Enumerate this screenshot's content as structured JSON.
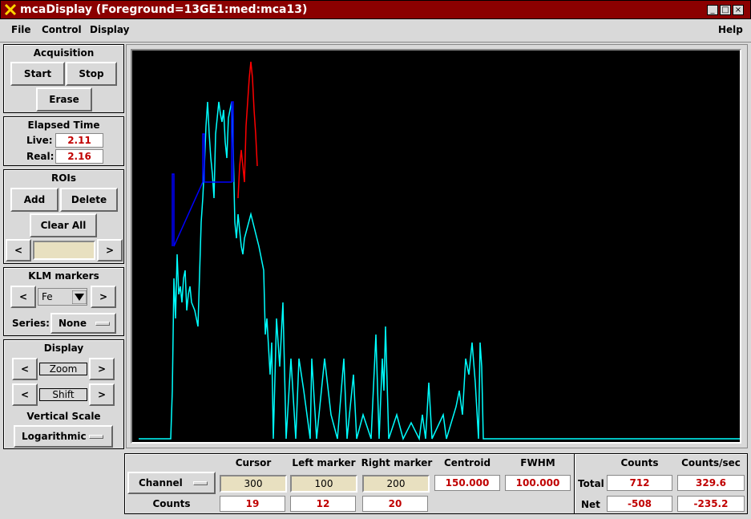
{
  "window": {
    "title": "mcaDisplay (Foreground=13GE1:med:mca13)"
  },
  "menu": {
    "file": "File",
    "control": "Control",
    "display": "Display",
    "help": "Help"
  },
  "acquisition": {
    "title": "Acquisition",
    "start": "Start",
    "stop": "Stop",
    "erase": "Erase"
  },
  "elapsed": {
    "title": "Elapsed Time",
    "live_label": "Live:",
    "live_value": "2.11",
    "real_label": "Real:",
    "real_value": "2.16"
  },
  "rois": {
    "title": "ROIs",
    "add": "Add",
    "delete": "Delete",
    "clear_all": "Clear All",
    "prev": "<",
    "next": ">",
    "field_value": ""
  },
  "klm": {
    "title": "KLM markers",
    "prev": "<",
    "next": ">",
    "element": "Fe",
    "series_label": "Series:",
    "series_value": "None"
  },
  "display_panel": {
    "title": "Display",
    "zoom": "Zoom",
    "shift": "Shift",
    "prev": "<",
    "next": ">",
    "vscale_title": "Vertical Scale",
    "vscale_value": "Logarithmic"
  },
  "bottom": {
    "mode": "Channel",
    "headers": {
      "cursor": "Cursor",
      "left": "Left marker",
      "right": "Right marker",
      "centroid": "Centroid",
      "fwhm": "FWHM"
    },
    "cursor_value": "300",
    "left_value": "100",
    "right_value": "200",
    "centroid_value": "150.000",
    "fwhm_value": "100.000",
    "counts_label": "Counts",
    "cursor_counts": "19",
    "left_counts": "12",
    "right_counts": "20"
  },
  "totals": {
    "counts_header": "Counts",
    "cps_header": "Counts/sec",
    "total_label": "Total",
    "total_counts": "712",
    "total_cps": "329.6",
    "net_label": "Net",
    "net_counts": "-508",
    "net_cps": "-235.2"
  },
  "colors": {
    "title_bg": "#8b0000",
    "spectrum": "#00ffff",
    "roi": "#ff0000",
    "marker": "#0000ff",
    "value_text": "#c00000"
  },
  "chart_data": {
    "type": "line",
    "description_scale": "logarithmic",
    "series": [
      {
        "color": "#00ffff",
        "points": [
          [
            0,
            0
          ],
          [
            40,
            0
          ],
          [
            42,
            60
          ],
          [
            44,
            200
          ],
          [
            46,
            150
          ],
          [
            48,
            230
          ],
          [
            50,
            180
          ],
          [
            52,
            190
          ],
          [
            54,
            170
          ],
          [
            56,
            200
          ],
          [
            58,
            210
          ],
          [
            60,
            160
          ],
          [
            62,
            180
          ],
          [
            64,
            190
          ],
          [
            66,
            170
          ],
          [
            70,
            160
          ],
          [
            74,
            140
          ],
          [
            78,
            270
          ],
          [
            80,
            300
          ],
          [
            82,
            340
          ],
          [
            84,
            390
          ],
          [
            86,
            420
          ],
          [
            88,
            380
          ],
          [
            90,
            350
          ],
          [
            92,
            330
          ],
          [
            94,
            300
          ],
          [
            96,
            380
          ],
          [
            98,
            400
          ],
          [
            100,
            420
          ],
          [
            102,
            405
          ],
          [
            104,
            395
          ],
          [
            106,
            410
          ],
          [
            108,
            370
          ],
          [
            110,
            350
          ],
          [
            112,
            400
          ],
          [
            114,
            410
          ],
          [
            116,
            420
          ],
          [
            118,
            360
          ],
          [
            120,
            270
          ],
          [
            122,
            250
          ],
          [
            124,
            280
          ],
          [
            126,
            260
          ],
          [
            128,
            240
          ],
          [
            130,
            230
          ],
          [
            132,
            250
          ],
          [
            140,
            280
          ],
          [
            150,
            240
          ],
          [
            156,
            210
          ],
          [
            158,
            130
          ],
          [
            160,
            150
          ],
          [
            164,
            80
          ],
          [
            166,
            120
          ],
          [
            168,
            0
          ],
          [
            172,
            150
          ],
          [
            176,
            90
          ],
          [
            180,
            170
          ],
          [
            184,
            0
          ],
          [
            190,
            100
          ],
          [
            196,
            0
          ],
          [
            200,
            100
          ],
          [
            206,
            60
          ],
          [
            214,
            0
          ],
          [
            216,
            100
          ],
          [
            222,
            0
          ],
          [
            232,
            100
          ],
          [
            240,
            30
          ],
          [
            248,
            0
          ],
          [
            256,
            100
          ],
          [
            260,
            0
          ],
          [
            268,
            80
          ],
          [
            272,
            0
          ],
          [
            280,
            30
          ],
          [
            290,
            0
          ],
          [
            296,
            130
          ],
          [
            300,
            0
          ],
          [
            304,
            100
          ],
          [
            306,
            60
          ],
          [
            308,
            140
          ],
          [
            312,
            0
          ],
          [
            322,
            30
          ],
          [
            330,
            0
          ],
          [
            340,
            20
          ],
          [
            350,
            0
          ],
          [
            354,
            30
          ],
          [
            358,
            0
          ],
          [
            362,
            70
          ],
          [
            366,
            0
          ],
          [
            380,
            30
          ],
          [
            384,
            0
          ],
          [
            396,
            40
          ],
          [
            400,
            60
          ],
          [
            404,
            30
          ],
          [
            408,
            100
          ],
          [
            412,
            80
          ],
          [
            416,
            120
          ],
          [
            420,
            70
          ],
          [
            424,
            0
          ],
          [
            426,
            120
          ],
          [
            428,
            90
          ],
          [
            430,
            0
          ],
          [
            760,
            0
          ]
        ]
      },
      {
        "color": "#ff0000",
        "points": [
          [
            124,
            300
          ],
          [
            126,
            340
          ],
          [
            128,
            360
          ],
          [
            130,
            340
          ],
          [
            132,
            320
          ],
          [
            134,
            390
          ],
          [
            136,
            420
          ],
          [
            138,
            450
          ],
          [
            140,
            470
          ],
          [
            142,
            450
          ],
          [
            144,
            410
          ],
          [
            146,
            380
          ],
          [
            148,
            340
          ]
        ]
      },
      {
        "color": "#0000ff",
        "points": [
          [
            42,
            240
          ],
          [
            42,
            330
          ],
          [
            44,
            330
          ],
          [
            44,
            240
          ],
          [
            80,
            320
          ],
          [
            80,
            380
          ],
          [
            82,
            380
          ],
          [
            82,
            320
          ],
          [
            116,
            320
          ],
          [
            116,
            420
          ],
          [
            118,
            420
          ],
          [
            118,
            320
          ]
        ]
      }
    ]
  }
}
